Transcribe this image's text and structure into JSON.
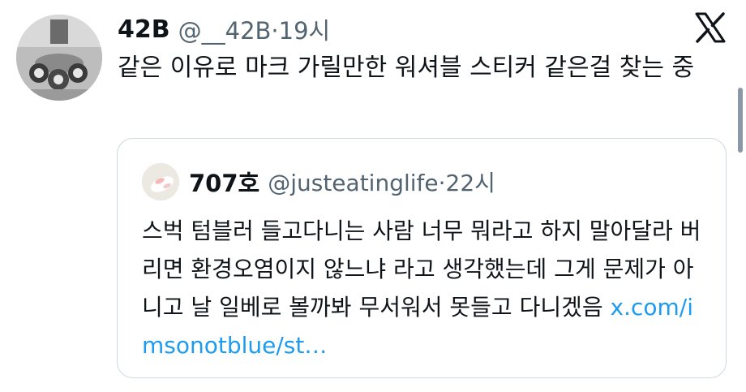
{
  "tweet": {
    "display_name": "42B",
    "handle": "@__42B",
    "separator": "·",
    "time": "19시",
    "text": "같은 이유로 마크 가릴만한 워셔블 스티커 같은걸 찾는 중",
    "avatar_icon": "user-avatar-photo",
    "logo_icon": "x-logo-icon"
  },
  "quote": {
    "display_name": "707호",
    "handle": "@justeatinglife",
    "separator": "·",
    "time": "22시",
    "text": "스벅 텀블러 들고다니는 사람 너무 뭐라고 하지 말아달라 버리면 환경오염이지 않느냐 라고 생각했는데 그게 문제가 아니고 날 일베로 볼까봐 무서워서 못들고 다니겠음 ",
    "link": "x.com/imsonotblue/st…",
    "avatar_icon": "user-avatar-photo"
  },
  "colors": {
    "text": "#0f1419",
    "secondary": "#536471",
    "link": "#1d9bf0",
    "border": "#cfd9de"
  }
}
